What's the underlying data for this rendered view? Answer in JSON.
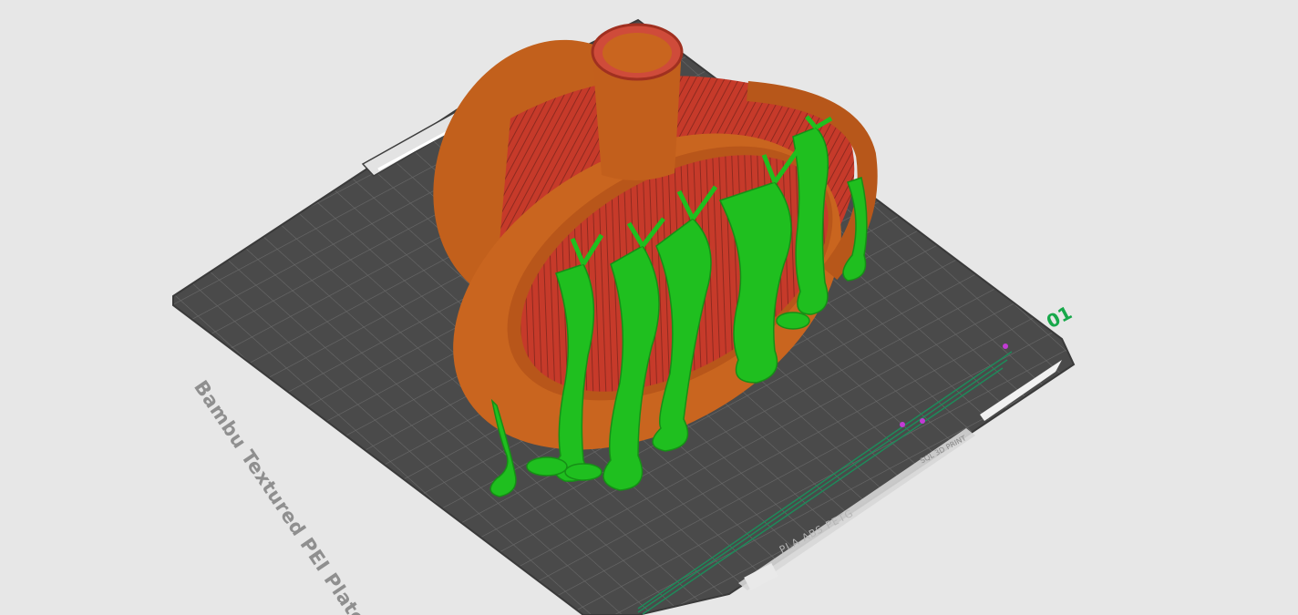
{
  "viewport": {
    "background": "#e7e7e7",
    "plate": {
      "name": "Bambu Textured PEI Plate",
      "number": "01",
      "materials": "PLA ABS PETG",
      "engraving": "SQL 3D PRINT",
      "colors": {
        "plate": "#4a4a4a",
        "grid": "#6b6b6b",
        "label": "#8f8f8f",
        "number": "#17a84a"
      }
    },
    "model": {
      "colors": {
        "body": "#c9651f",
        "infill": "#c63a2a",
        "supports": "#1fbf1f"
      }
    }
  }
}
